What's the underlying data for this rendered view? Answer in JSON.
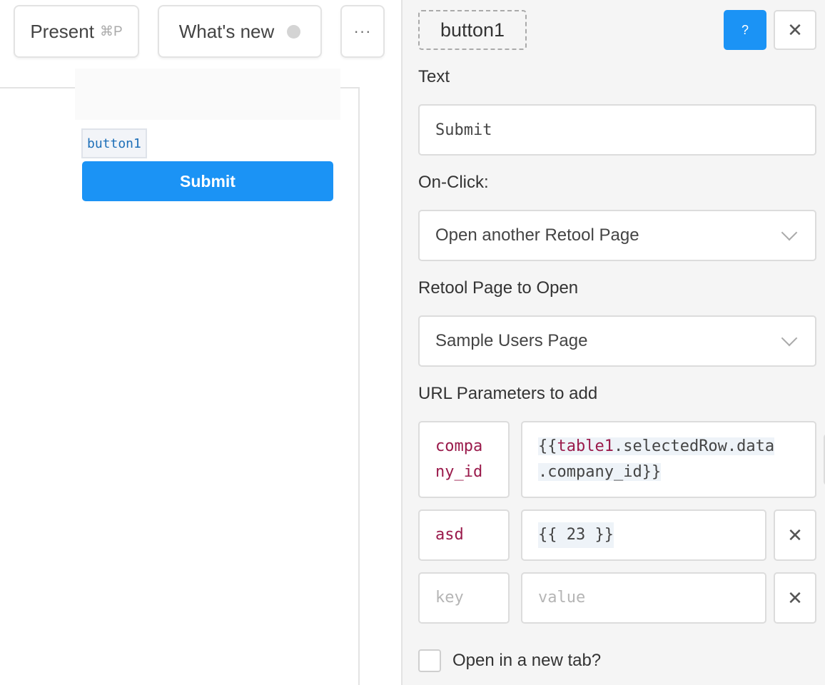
{
  "toolbar": {
    "present_label": "Present",
    "present_shortcut": "⌘P",
    "whats_new_label": "What's new",
    "more_label": "···"
  },
  "canvas": {
    "component_tag": "button1",
    "component_button_label": "Submit"
  },
  "inspector": {
    "title": "button1",
    "help_label": "?",
    "close_label": "✕",
    "text_label": "Text",
    "text_value": "Submit",
    "onclick_label": "On-Click:",
    "onclick_value": "Open another Retool Page",
    "page_label": "Retool Page to Open",
    "page_value": "Sample Users Page",
    "params_label": "URL Parameters to add",
    "params": [
      {
        "key": "company_id",
        "key_line1": "compa",
        "key_line2": "ny_id",
        "value_line1_prefix": "{{",
        "value_line1_hl": "table1",
        "value_line1_rest": ".selectedRow.data",
        "value_line2": ".company_id}}"
      },
      {
        "key": "asd",
        "value": "{{ 23 }}"
      }
    ],
    "new_param_key_placeholder": "key",
    "new_param_value_placeholder": "value",
    "remove_label": "✕",
    "new_tab_label": "Open in a new tab?",
    "new_tab_checked": false
  },
  "colors": {
    "accent": "#1b93f5",
    "code_key": "#9a1a4b",
    "tag_text": "#1e6fb8"
  }
}
